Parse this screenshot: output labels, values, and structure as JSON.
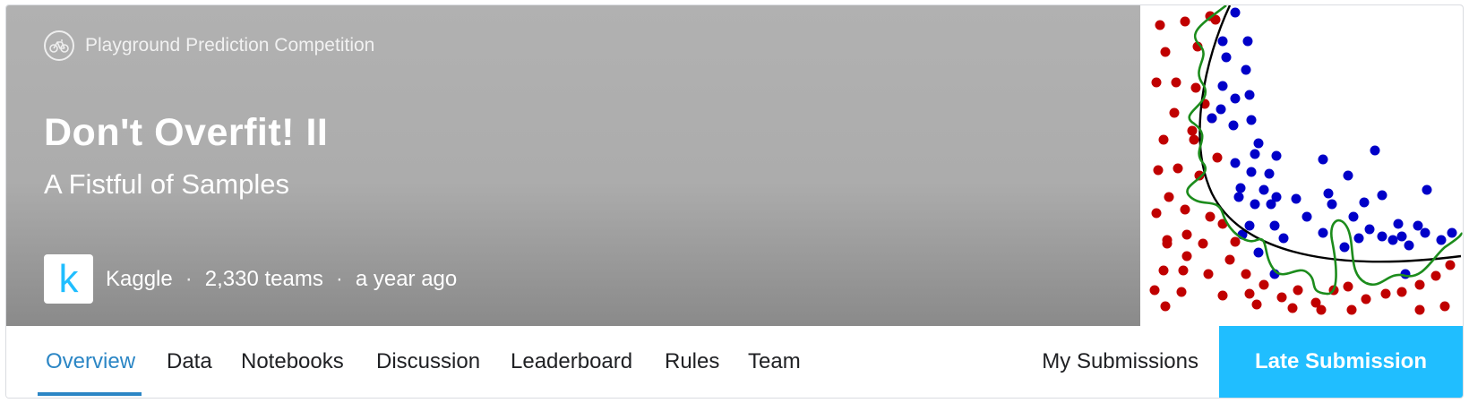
{
  "header": {
    "competition_type": "Playground Prediction Competition",
    "competition_icon": "bike-icon",
    "title": "Don't Overfit! II",
    "subtitle": "A Fistful of Samples",
    "host_logo_letter": "k",
    "host": "Kaggle",
    "separator": "·",
    "teams": "2,330 teams",
    "age": "a year ago"
  },
  "tabs": [
    {
      "label": "Overview",
      "active": true
    },
    {
      "label": "Data"
    },
    {
      "label": "Notebooks"
    },
    {
      "label": "Discussion"
    },
    {
      "label": "Leaderboard"
    },
    {
      "label": "Rules"
    },
    {
      "label": "Team"
    }
  ],
  "actions": {
    "my_submissions": "My Submissions",
    "late_submission": "Late Submission"
  },
  "colors": {
    "accent": "#20beff",
    "active_tab": "#2b86c5",
    "red_points": "#c00000",
    "blue_points": "#0000c8",
    "overfit_curve": "#1c8c1c",
    "true_boundary": "#000000"
  }
}
